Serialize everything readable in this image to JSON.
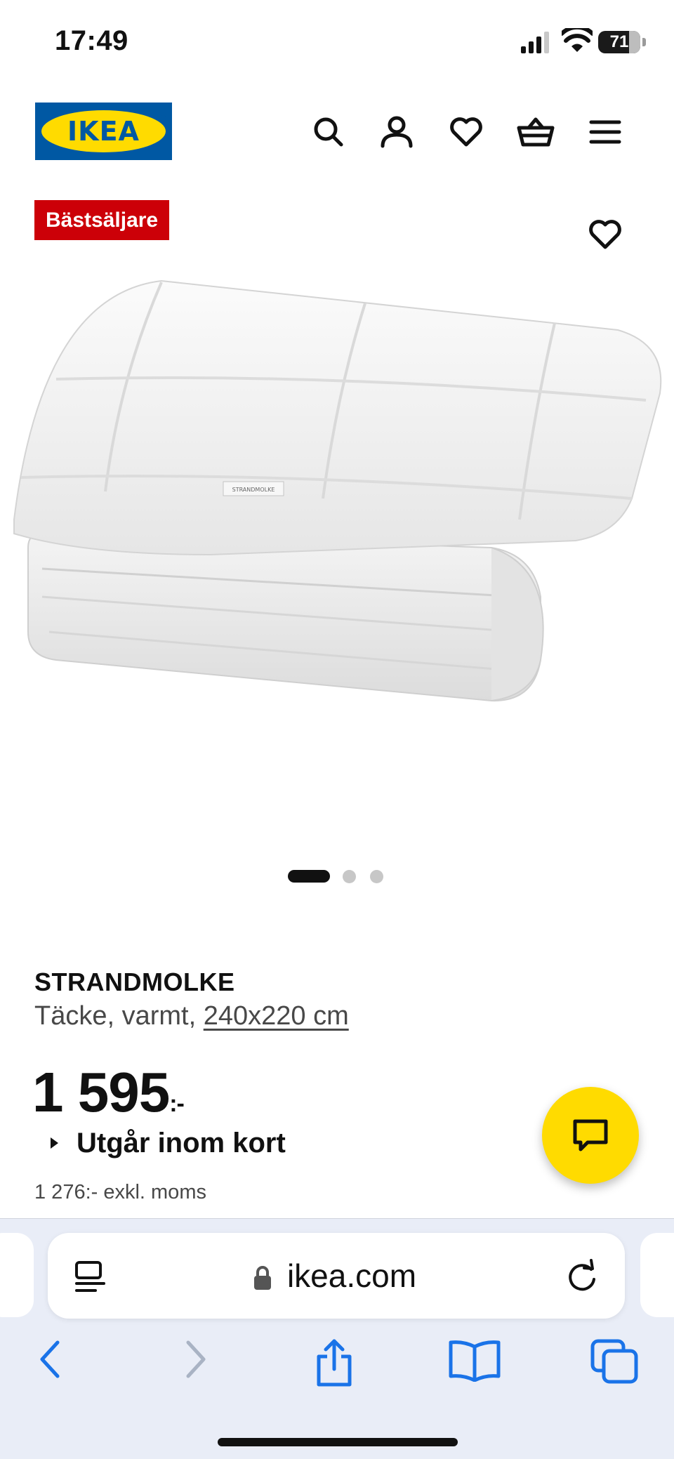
{
  "status_bar": {
    "time": "17:49",
    "battery": "71"
  },
  "header": {
    "logo_text": "IKEA",
    "icons": [
      "search-icon",
      "profile-icon",
      "heart-icon",
      "basket-icon",
      "menu-icon"
    ]
  },
  "product": {
    "badge": "Bästsäljare",
    "name": "STRANDMOLKE",
    "description": "Täcke, varmt,",
    "size": "240x220 cm",
    "price": "1 595",
    "price_suffix": ":-",
    "availability": "Utgår inom kort",
    "excl_vat": "1 276:- exkl. moms",
    "tag_text": "STRANDMOLKE",
    "image_count": 3,
    "active_image": 1
  },
  "browser": {
    "url": "ikea.com",
    "toolbar": [
      "back-icon",
      "forward-icon",
      "share-icon",
      "bookmarks-icon",
      "tabs-icon"
    ]
  },
  "colors": {
    "ikea_blue": "#0058a3",
    "ikea_yellow": "#ffdb00",
    "badge_red": "#cc0008",
    "safari_blue": "#1a73e8"
  }
}
